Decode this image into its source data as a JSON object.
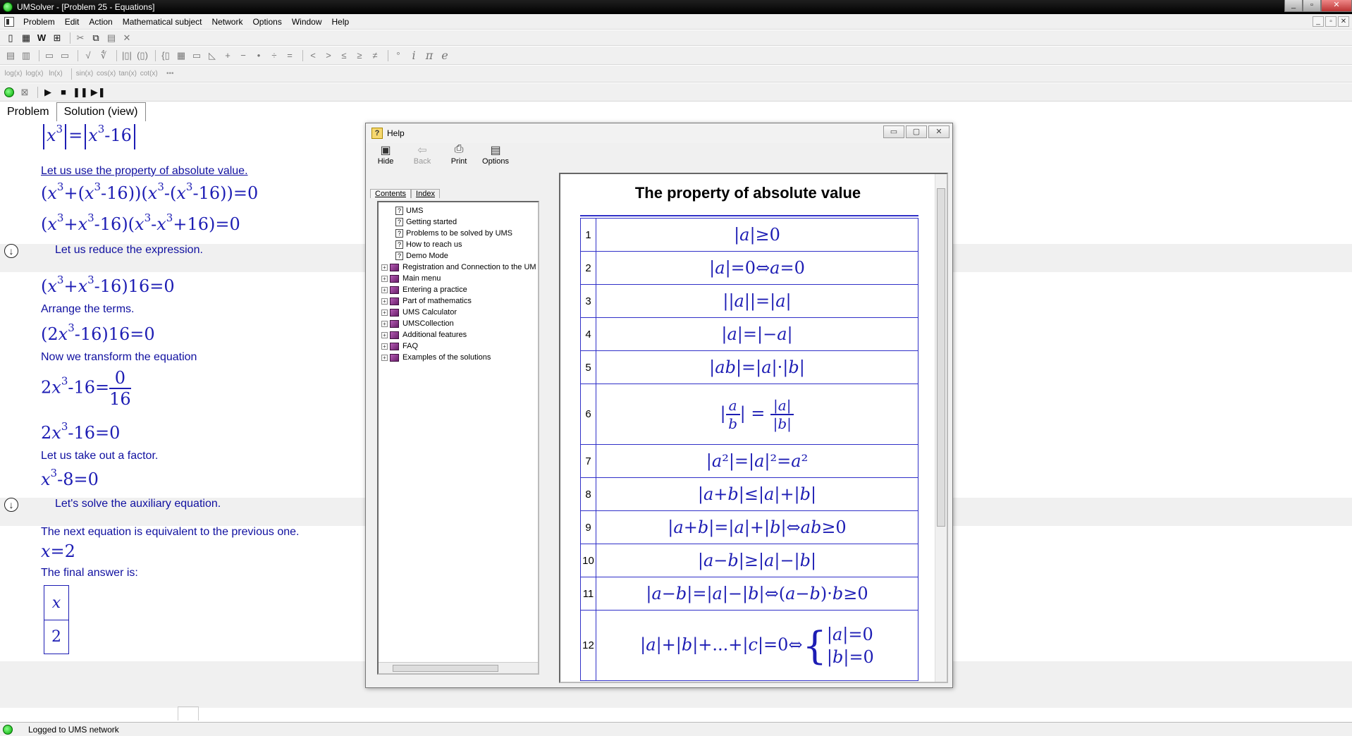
{
  "window": {
    "title": "UMSolver - [Problem 25 - Equations]",
    "buttons": [
      "_",
      "▫",
      "✕"
    ]
  },
  "menubar": {
    "items": [
      "Problem",
      "Edit",
      "Action",
      "Mathematical subject",
      "Network",
      "Options",
      "Window",
      "Help"
    ],
    "mdi_buttons": [
      "_",
      "▫",
      "✕"
    ]
  },
  "toolbar_fn_labels": [
    "log(x)",
    "log(x)",
    "ln(x)",
    "sin(x)",
    "cos(x)",
    "tan(x)",
    "cot(x)",
    "•••"
  ],
  "toolbar_symbols": [
    "+",
    "−",
    "•",
    "÷",
    "=",
    "<",
    ">",
    "≤",
    "≥",
    "≠",
    "°",
    "i",
    "π",
    "e"
  ],
  "tabs": [
    "Problem",
    "Solution (view)"
  ],
  "solution": {
    "s1_text": "Let us use the property of absolute value.",
    "s2_text": "Let us reduce the expression.",
    "s3_text": "Arrange the terms.",
    "s4_text": "Now we transform the equation",
    "s5_text": "Let us take out a factor.",
    "s6_text": "Let's solve the auxiliary equation.",
    "s7_text": "The next equation is equivalent to the previous one.",
    "s8_text": "The final answer is:",
    "answer_header": "x",
    "answer_value": "2"
  },
  "help": {
    "title": "Help",
    "window_buttons": [
      "▭",
      "▢",
      "✕"
    ],
    "toolbar": {
      "hide": "Hide",
      "back": "Back",
      "print": "Print",
      "options": "Options"
    },
    "tabs": {
      "contents": "Contents",
      "index": "Index"
    },
    "topics": [
      "UMS",
      "Getting started",
      "Problems to be solved by UMS",
      "How to reach us",
      "Demo Mode"
    ],
    "books": [
      "Registration and Connection to the UM",
      "Main menu",
      "Entering a practice",
      "Part of mathematics",
      "UMS Calculator",
      "UMSCollection",
      "Additional features",
      "FAQ",
      "Examples of the solutions"
    ],
    "heading": "The property of absolute value",
    "row_numbers": [
      "1",
      "2",
      "3",
      "4",
      "5",
      "6",
      "7",
      "8",
      "9",
      "10",
      "11",
      "12"
    ]
  },
  "status": {
    "text": "Logged to UMS network"
  }
}
